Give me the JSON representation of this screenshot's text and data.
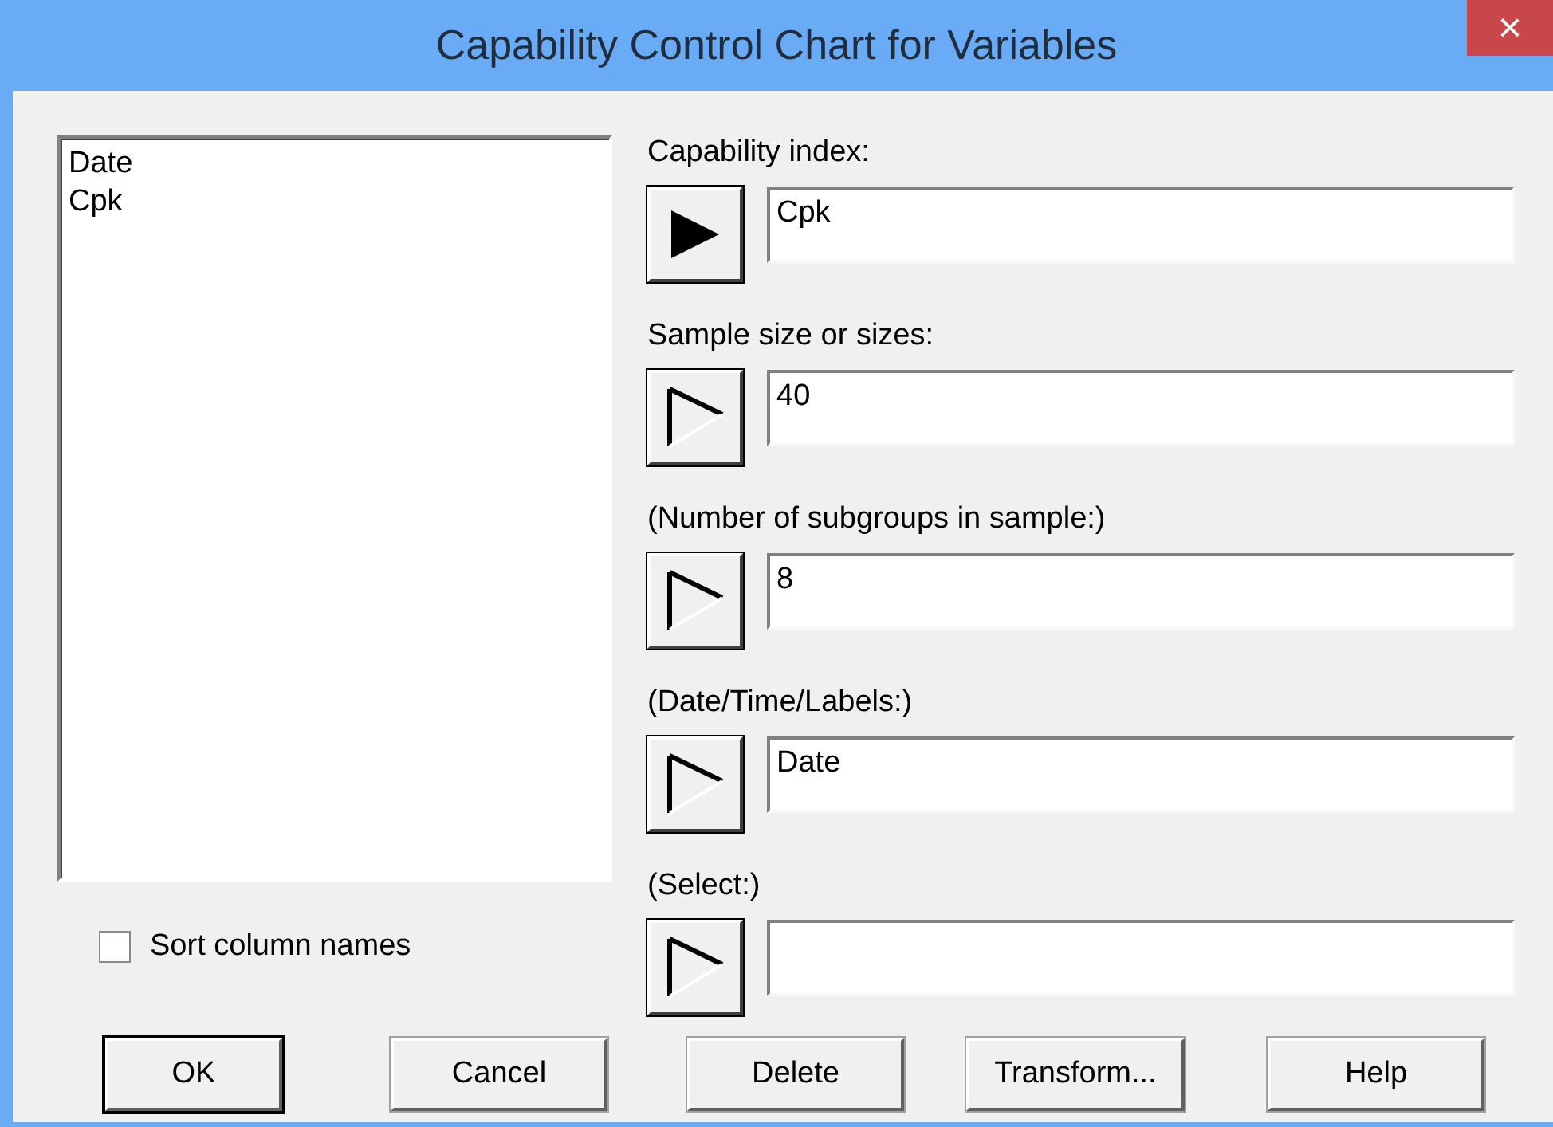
{
  "window": {
    "title": "Capability Control Chart for Variables",
    "close": "×"
  },
  "column_list": {
    "items": [
      {
        "label": "Date",
        "selected": false
      },
      {
        "label": "Cpk",
        "selected": false
      }
    ]
  },
  "sort_column_names": {
    "label": "Sort column names",
    "checked": false
  },
  "fields": [
    {
      "label": "Capability index:",
      "value": "Cpk",
      "kind": "filled"
    },
    {
      "label": "Sample size or sizes:",
      "value": "40",
      "kind": "outline"
    },
    {
      "label": "(Number of subgroups in sample:)",
      "value": "8",
      "kind": "outline"
    },
    {
      "label": "(Date/Time/Labels:)",
      "value": "Date",
      "kind": "outline"
    },
    {
      "label": "(Select:)",
      "kind": "outline"
    }
  ],
  "buttons": [
    {
      "label": "OK",
      "kind": "default"
    },
    {
      "label": "Cancel",
      "kind": "normal"
    },
    {
      "label": "Delete",
      "kind": "normal"
    },
    {
      "label": "Transform...",
      "kind": "normal"
    },
    {
      "label": "Help",
      "kind": "normal"
    }
  ]
}
